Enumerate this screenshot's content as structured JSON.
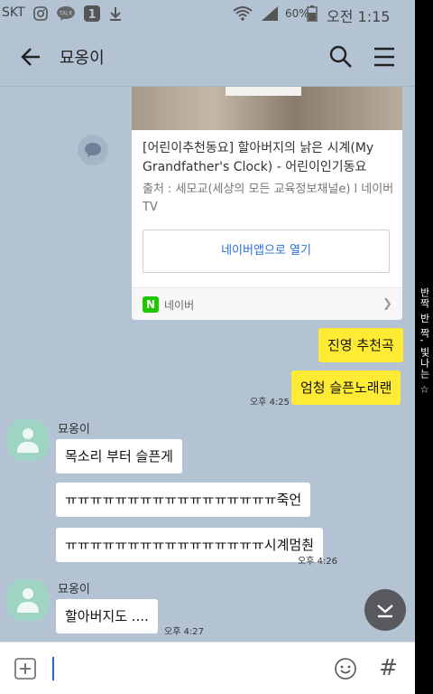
{
  "status_bar": {
    "carrier": "SKT",
    "battery": "60%",
    "clock": "오전 1:15"
  },
  "header": {
    "title": "묘옹이"
  },
  "link_card": {
    "title": "[어린이추천동요] 할아버지의 낡은 시계(My Grandfather's Clock) - 어린이인기동요",
    "description": "출처 : 세모교(세상의 모든 교육정보채널e) l 네이버TV",
    "open_button": "네이버앱으로 열기",
    "source_logo": "N",
    "source_name": "네이버"
  },
  "messages": {
    "m1": "진영 추천곡",
    "m2": "엄청 슬픈노래랜",
    "t1": "오후 4:25",
    "sender1": "묘옹이",
    "r1": "목소리 부터 슬픈게",
    "r2": "ㅠㅠㅠㅠㅠㅠㅠㅠㅠㅠㅠㅠㅠㅠㅠㅠㅠ죽언",
    "r3": "ㅠㅠㅠㅠㅠㅠㅠㅠㅠㅠㅠㅠㅠㅠㅠㅠ시계멈춴",
    "t2": "오후 4:26",
    "sender2": "묘옹이",
    "r4": "할아버지도 ....",
    "t3": "오후 4:27"
  },
  "input": {
    "value": "",
    "hash": "#"
  },
  "side_text": "반짝 반 짝, 빛나는 ☆",
  "colors": {
    "chat_bg": "#b3c3d4",
    "my_bubble": "#ffeb33",
    "their_bubble": "#ffffff",
    "link_blue": "#2a6fd6"
  }
}
